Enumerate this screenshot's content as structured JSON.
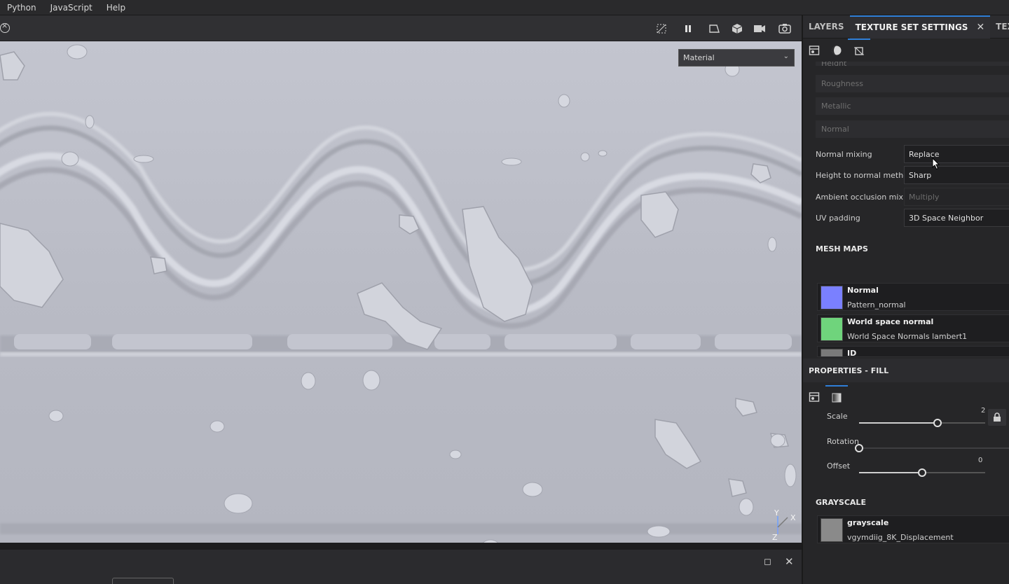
{
  "menu": [
    "Python",
    "JavaScript",
    "Help"
  ],
  "viewport": {
    "material_select": "Material",
    "axis": {
      "y": "Y",
      "x": "X",
      "z": "Z"
    }
  },
  "tabs": [
    {
      "label": "LAYERS"
    },
    {
      "label": "TEXTURE SET SETTINGS",
      "active": true
    },
    {
      "label": "TEXTURE SE"
    }
  ],
  "channels": [
    "Height",
    "Roughness",
    "Metallic",
    "Normal"
  ],
  "properties": [
    {
      "label": "Normal mixing",
      "value": "Replace",
      "dim": false
    },
    {
      "label": "Height to normal method",
      "value": "Sharp",
      "dim": false
    },
    {
      "label": "Ambient occlusion mixing",
      "value": "Multiply",
      "dim": true
    },
    {
      "label": "UV padding",
      "value": "3D Space Neighbor",
      "dim": false
    }
  ],
  "mesh_maps": {
    "title": "MESH MAPS",
    "items": [
      {
        "name": "Normal",
        "value": "Pattern_normal",
        "color": "#7a80ff"
      },
      {
        "name": "World space normal",
        "value": "World Space Normals lambert1",
        "color": "#6fd47c"
      },
      {
        "name": "ID",
        "value": "",
        "color": "#7a7a7a"
      }
    ]
  },
  "properties_fill": {
    "title": "PROPERTIES - FILL",
    "scale_label": "Scale",
    "scale_value": "2",
    "rotation_label": "Rotation",
    "offset_label": "Offset",
    "offset_value": "0",
    "scale_fraction": 0.62,
    "rotation_fraction": 0.0,
    "offset_fraction": 0.5
  },
  "grayscale": {
    "title": "GRAYSCALE",
    "name": "grayscale",
    "value": "vgymdiig_8K_Displacement",
    "color": "#8a8a8a"
  }
}
